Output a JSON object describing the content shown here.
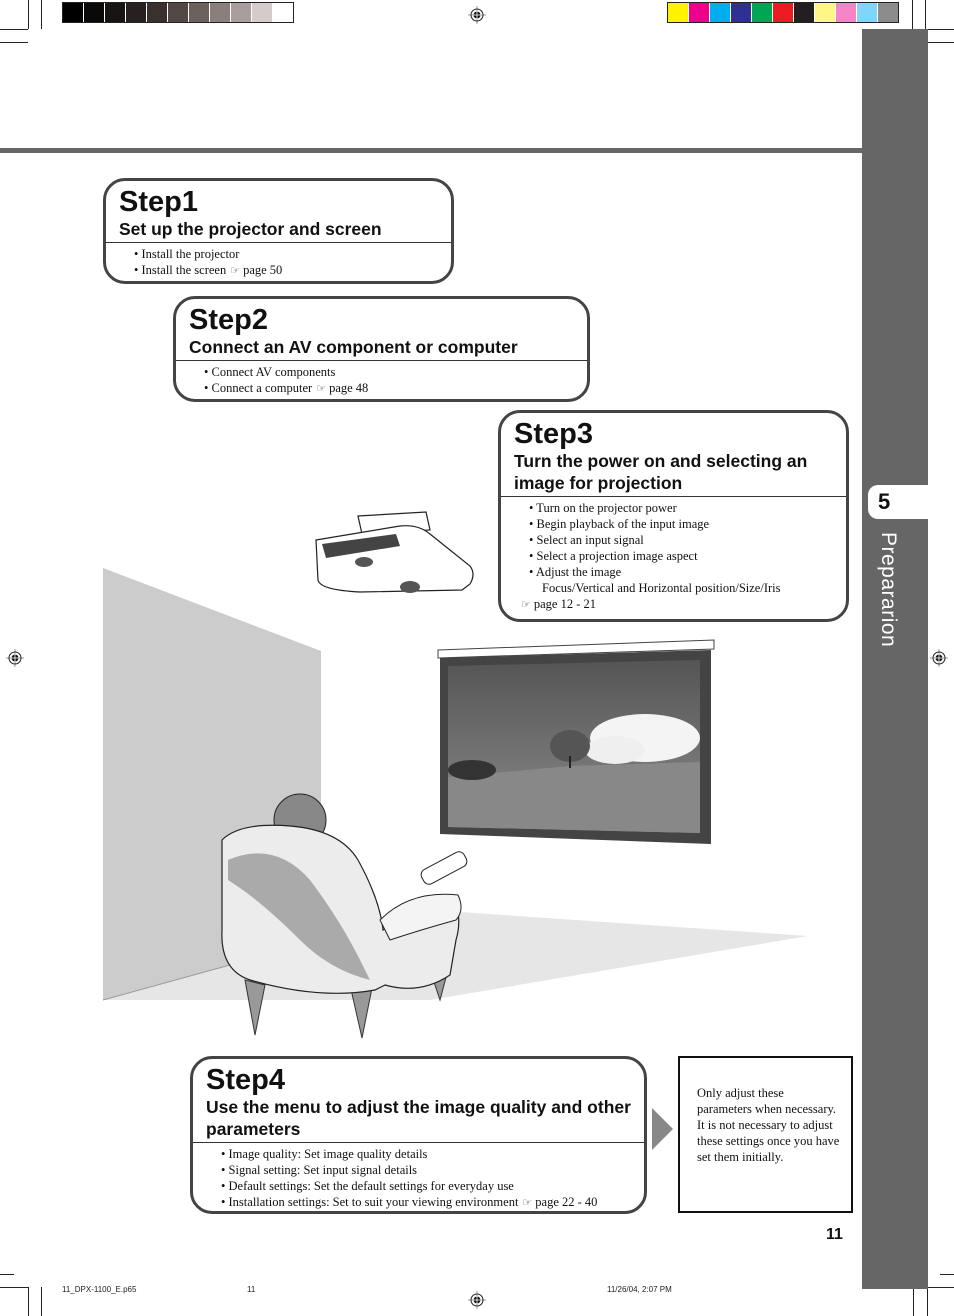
{
  "print_marks": {
    "gray_swatches": [
      "#000000",
      "#0a0908",
      "#171413",
      "#262120",
      "#3a302e",
      "#524846",
      "#6b615f",
      "#8a7f7d",
      "#a89f9d",
      "#d3cccb",
      "#ffffff"
    ],
    "color_swatches": [
      "#fff200",
      "#ec008c",
      "#00aeef",
      "#2e3192",
      "#00a651",
      "#ed1c24",
      "#231f20",
      "#fff685",
      "#f585c8",
      "#7fd5fa",
      "#8c8c8c"
    ]
  },
  "sidebar": {
    "chapter_number": "5",
    "chapter_label": "Prepararion"
  },
  "steps": [
    {
      "title": "Step1",
      "subtitle": "Set up the projector and screen",
      "items": [
        "Install the projector",
        "Install the screen"
      ],
      "ref_page": "page 50"
    },
    {
      "title": "Step2",
      "subtitle": "Connect an AV component or computer",
      "items": [
        "Connect AV components",
        "Connect a computer"
      ],
      "ref_page": "page 48"
    },
    {
      "title": "Step3",
      "subtitle": "Turn the power on and selecting an image for projection",
      "items": [
        "Turn on the projector power",
        "Begin playback of the input image",
        "Select an input signal",
        "Select a projection image aspect",
        "Adjust the image"
      ],
      "detail": "Focus/Vertical and Horizontal position/Size/Iris",
      "ref_page": "page 12 - 21"
    },
    {
      "title": "Step4",
      "subtitle": "Use the menu to adjust the image quality and other parameters",
      "items": [
        "Image quality: Set image quality details",
        "Signal setting: Set input signal details",
        "Default settings: Set the default settings for everyday use",
        "Installation settings: Set to suit your viewing environment"
      ],
      "ref_page": "page 22 - 40"
    }
  ],
  "note": "Only adjust these parameters when necessary.  It is not necessary to adjust these settings once you have set them initially.",
  "ref_icon": "☞",
  "page_number": "11",
  "footer": {
    "file": "11_DPX-1100_E.p65",
    "page": "11",
    "timestamp": "11/26/04, 2:07 PM"
  },
  "illustration": {
    "description": "Person seated in armchair holding remote, ceiling-mounted projector, wall screen showing landscape with tree"
  }
}
